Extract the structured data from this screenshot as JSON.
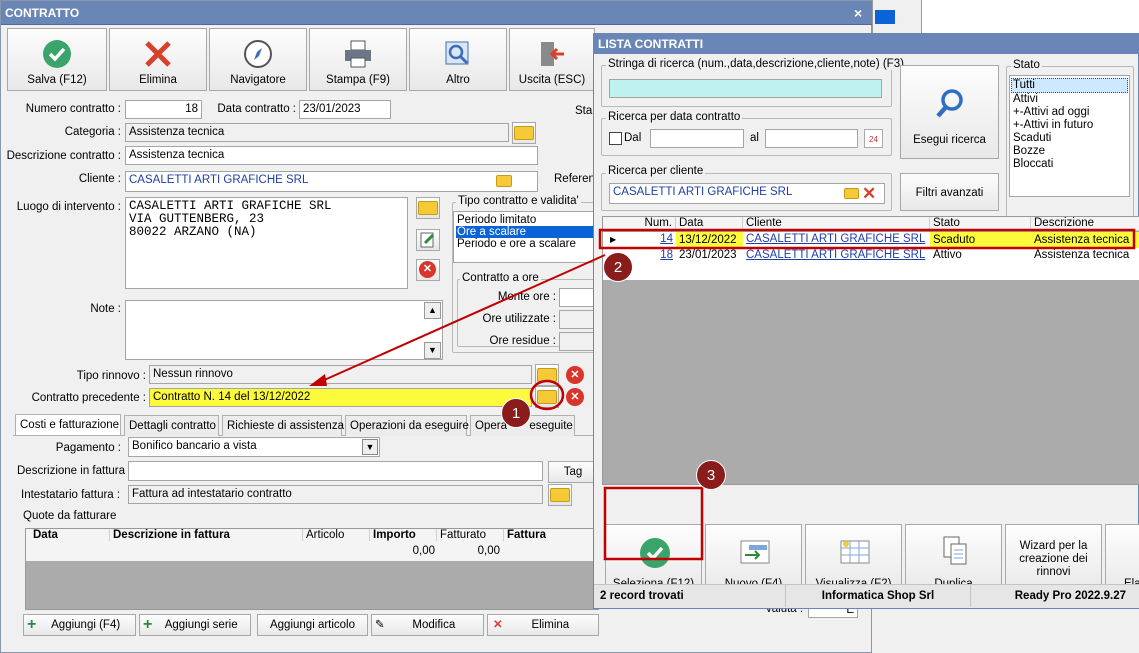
{
  "contratto": {
    "title": "CONTRATTO",
    "close": "×",
    "toolbar": {
      "salva": "Salva (F12)",
      "elimina": "Elimina",
      "navigatore": "Navigatore",
      "stampa": "Stampa (F9)",
      "altro": "Altro",
      "uscita": "Uscita (ESC)"
    },
    "numero_label": "Numero contratto :",
    "numero_value": "18",
    "data_label": "Data contratto :",
    "data_value": "23/01/2023",
    "sta_label": "Sta",
    "categoria_label": "Categoria :",
    "categoria_value": "Assistenza tecnica",
    "descr_label": "Descrizione contratto :",
    "descr_value": "Assistenza tecnica",
    "cliente_label": "Cliente :",
    "cliente_value": "CASALETTI ARTI GRAFICHE SRL",
    "referen_label": "Referen",
    "luogo_label": "Luogo di intervento :",
    "luogo_lines": [
      "CASALETTI ARTI GRAFICHE SRL",
      "VIA GUTTENBERG, 23",
      "80022 ARZANO (NA)"
    ],
    "tipo_group": "Tipo contratto e validita'",
    "tipo_options": [
      "Periodo limitato",
      "Ore a scalare",
      "Periodo e ore a scalare"
    ],
    "ore_group": "Contratto a ore",
    "monte_label": "Monte ore :",
    "utilizzate_label": "Ore utilizzate :",
    "residue_label": "Ore residue :",
    "note_label": "Note :",
    "rinnovo_label": "Tipo rinnovo :",
    "rinnovo_value": "Nessun rinnovo",
    "precedente_label": "Contratto precedente :",
    "precedente_value": "Contratto N. 14 del 13/12/2022",
    "tabs": [
      "Costi e fatturazione",
      "Dettagli contratto",
      "Richieste di assistenza",
      "Operazioni da eseguire",
      "Operazioni eseguite"
    ],
    "tab_prefix": "Opera",
    "tab_suffix": "eseguite",
    "pagamento_label": "Pagamento :",
    "pagamento_value": "Bonifico bancario a vista",
    "descr_fatt_label": "Descrizione in fattura",
    "tag": "Tag",
    "intestatario_label": "Intestatario fattura :",
    "intestatario_value": "Fattura ad intestatario contratto",
    "quote_label": "Quote da fatturare",
    "quote_headers": [
      "Data",
      "Descrizione in fattura",
      "Articolo",
      "Importo",
      "Fatturato",
      "Fattura"
    ],
    "quote_importo": "0,00",
    "quote_fatturato": "0,00",
    "valuta_label": "valuta :",
    "valuta_value": "E",
    "bottom_buttons": [
      "Aggiungi (F4)",
      "Aggiungi serie",
      "Aggiungi articolo",
      "Modifica",
      "Elimina"
    ]
  },
  "lista": {
    "title": "LISTA CONTRATTI",
    "stringa_label": "Stringa di ricerca (num.,data,descrizione,cliente,note) (F3)",
    "data_group": "Ricerca per data contratto",
    "dal": "Dal",
    "al": "al",
    "cliente_group": "Ricerca per cliente",
    "cliente_value": "CASALETTI ARTI GRAFICHE SRL",
    "esegui": "Esegui ricerca",
    "filtri": "Filtri avanzati",
    "stato_group": "Stato",
    "stato_items": [
      "Tutti",
      "Attivi",
      "+-Attivi ad oggi",
      "+-Attivi in futuro",
      "Scaduti",
      "Bozze",
      "Bloccati"
    ],
    "headers": [
      "Num.",
      "Data",
      "Cliente",
      "Stato",
      "Descrizione"
    ],
    "rows": [
      {
        "num": "14",
        "data": "13/12/2022",
        "cliente": "CASALETTI ARTI GRAFICHE SRL",
        "stato": "Scaduto",
        "descr": "Assistenza tecnica"
      },
      {
        "num": "18",
        "data": "23/01/2023",
        "cliente": "CASALETTI ARTI GRAFICHE SRL",
        "stato": "Attivo",
        "descr": "Assistenza tecnica"
      }
    ],
    "bottom": {
      "seleziona": "Seleziona (F12)",
      "nuovo": "Nuovo (F4)",
      "visualizza": "Visualizza (F2)",
      "duplica": "Duplica",
      "wizard": "Wizard per la creazione dei rinnovi",
      "ela": "Ela"
    },
    "status": {
      "records": "2 record trovati",
      "company": "Informatica Shop Srl",
      "version": "Ready Pro 2022.9.27"
    }
  },
  "annotations": [
    "1",
    "2",
    "3"
  ],
  "colors": {
    "titlebar": "#6a86b6",
    "highlight": "#fbfb3c",
    "annotation": "#c00000",
    "search_bg": "#bff2ee",
    "selection": "#0a64d8"
  }
}
